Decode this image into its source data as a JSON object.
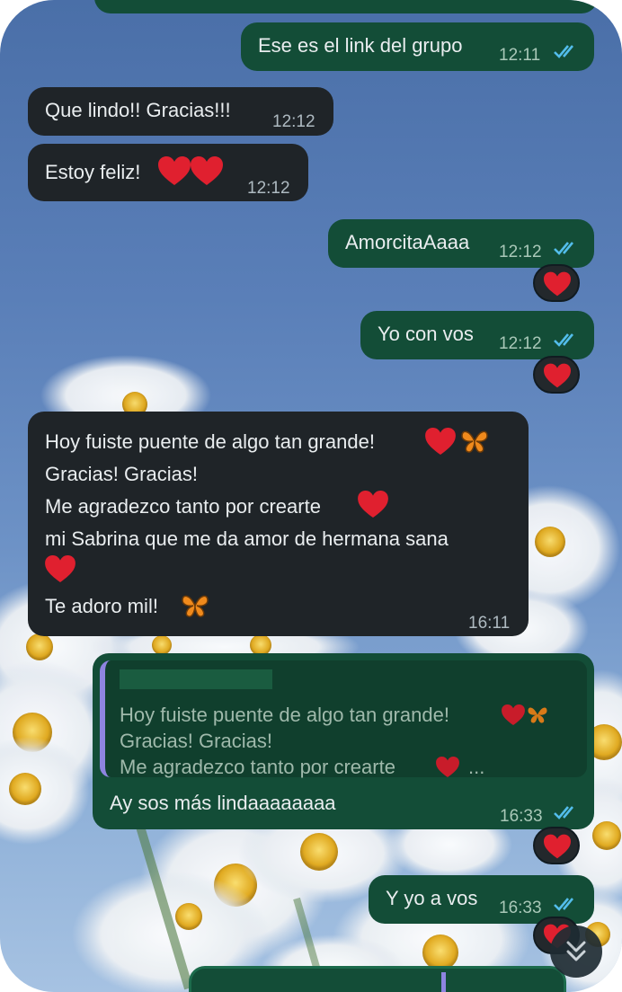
{
  "messages": [
    {
      "id": "m1",
      "direction": "out",
      "text": "Ese es el link del grupo",
      "time": "12:11"
    },
    {
      "id": "m2",
      "direction": "in",
      "text": "Que lindo!! Gracias!!!",
      "time": "12:12"
    },
    {
      "id": "m3",
      "direction": "in",
      "text": "Estoy feliz!",
      "time": "12:12"
    },
    {
      "id": "m4",
      "direction": "out",
      "text": "AmorcitaAaaa",
      "time": "12:12"
    },
    {
      "id": "m5",
      "direction": "out",
      "text": "Yo con vos",
      "time": "12:12"
    },
    {
      "id": "m6",
      "direction": "in",
      "lines": [
        "Hoy fuiste puente de algo tan grande!",
        "Gracias! Gracias!",
        "Me agradezco tanto por crearte",
        "mi Sabrina que me da amor de hermana sana",
        "",
        "Te adoro mil!"
      ],
      "time": "16:11"
    },
    {
      "id": "m7",
      "direction": "out",
      "quote_lines": [
        "Hoy fuiste puente de algo tan grande!",
        "Gracias! Gracias!",
        "Me agradezco tanto por crearte",
        "..."
      ],
      "text": "Ay sos más lindaaaaaaaa",
      "time": "16:33"
    },
    {
      "id": "m8",
      "direction": "out",
      "text": "Y yo a vos",
      "time": "16:33"
    }
  ],
  "icons": {
    "read_ticks": "double-check-icon",
    "reaction": "red-heart-emoji",
    "butterfly": "butterfly-emoji",
    "scroll": "chevrons-down-icon"
  },
  "colors": {
    "incoming_bubble": "#1f2428",
    "outgoing_bubble": "#134d37",
    "ticks": "#53bdeb",
    "heart": "#e0202f",
    "quote_bar": "#8e84e0"
  }
}
